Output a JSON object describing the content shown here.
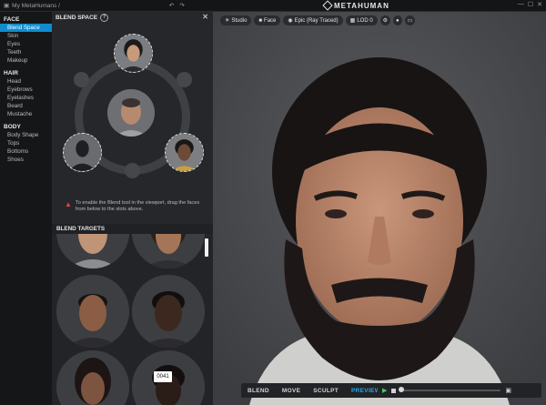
{
  "topbar": {
    "breadcrumb": "My MetaHumans /",
    "undo": "↶",
    "redo": "↷",
    "logo": "METAHUMAN",
    "minimize": "—",
    "maximize": "☐",
    "close": "✕"
  },
  "sidebar": {
    "sections": [
      {
        "title": "FACE",
        "items": [
          "Blend Space",
          "Skin",
          "Eyes",
          "Teeth",
          "Makeup"
        ]
      },
      {
        "title": "HAIR",
        "items": [
          "Head",
          "Eyebrows",
          "Eyelashes",
          "Beard",
          "Mustache"
        ]
      },
      {
        "title": "BODY",
        "items": [
          "Body Shape",
          "Tops",
          "Bottoms",
          "Shoes"
        ]
      }
    ],
    "active": "Blend Space"
  },
  "blend_panel": {
    "title": "BLEND SPACE",
    "help": "?",
    "close": "✕",
    "notice": "To enable the Blend tool in the viewport, drag the faces from below to the slots above.",
    "targets_title": "BLEND TARGETS",
    "tooltip": "0041"
  },
  "viewport": {
    "toolbar": [
      {
        "icon": "sun-icon",
        "label": "Studio"
      },
      {
        "icon": "camera-icon",
        "label": "Face"
      },
      {
        "icon": "eye-icon",
        "label": "Epic (Ray Traced)"
      },
      {
        "icon": "lod-icon",
        "label": "LOD 0"
      }
    ],
    "modes": [
      "BLEND",
      "MOVE",
      "SCULPT",
      "PREVIEW"
    ],
    "active_mode": "PREVIEW",
    "play": "▶",
    "timeline_progress": 0.0
  },
  "colors": {
    "accent": "#0f8ccf",
    "preview": "#2aa8f0",
    "play": "#3fd15b",
    "warning": "#e0463c"
  }
}
